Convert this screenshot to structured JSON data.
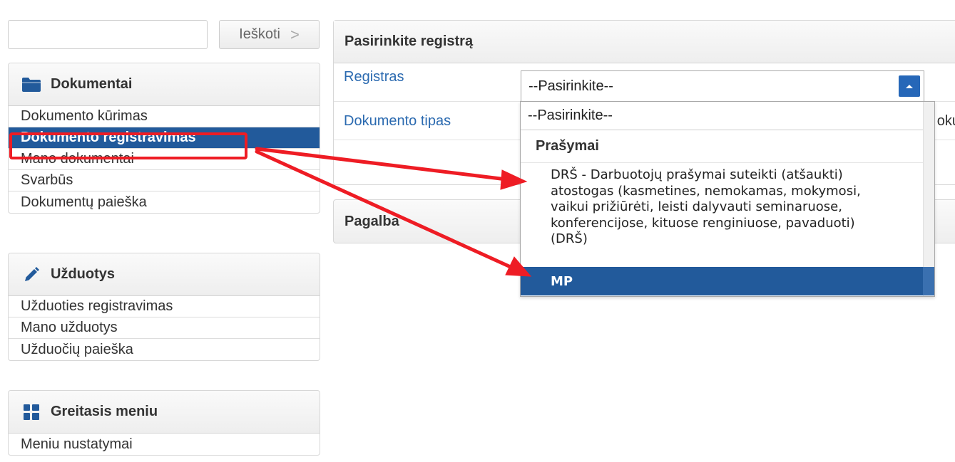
{
  "search": {
    "placeholder": "",
    "button_label": "Ieškoti",
    "button_chevron": ">"
  },
  "sidebar": {
    "documents": {
      "title": "Dokumentai",
      "icon": "folder-icon",
      "items": [
        {
          "label": "Dokumento kūrimas",
          "active": false
        },
        {
          "label": "Dokumento registravimas",
          "active": true
        },
        {
          "label": "Mano dokumentai",
          "active": false
        },
        {
          "label": "Svarbūs",
          "active": false
        },
        {
          "label": "Dokumentų paieška",
          "active": false
        }
      ]
    },
    "tasks": {
      "title": "Užduotys",
      "icon": "pencil-icon",
      "items": [
        {
          "label": "Užduoties registravimas"
        },
        {
          "label": "Mano užduotys"
        },
        {
          "label": "Užduočių paieška"
        }
      ]
    },
    "quickmenu": {
      "title": "Greitasis meniu",
      "icon": "grid-icon",
      "items": [
        {
          "label": "Meniu nustatymai"
        }
      ]
    }
  },
  "main": {
    "title": "Pasirinkite registrą",
    "fields": {
      "registry_label": "Registras",
      "registry_value": "--Pasirinkite--",
      "doctype_label": "Dokumento tipas",
      "doctype_cutoff": "oku"
    },
    "help_title": "Pagalba"
  },
  "dropdown": {
    "options": [
      "--Pasirinkite--"
    ],
    "group_label": "Prašymai",
    "group_options": [
      {
        "lines": [
          "DRŠ - Darbuotojų prašymai suteikti (atšaukti)",
          "atostogas (kasmetines, nemokamas, mokymosi,",
          "vaikui prižiūrėti, leisti dalyvauti seminaruose,",
          "konferencijose, kituose renginiuose, pavaduoti)",
          "(DRŠ)"
        ]
      },
      {
        "label": "MP",
        "selected": true
      }
    ]
  },
  "colors": {
    "active_bg": "#225a9b",
    "link_blue": "#2b6ab0",
    "annotation_red": "#ee1c24",
    "select_arrow_bg": "#2667b8"
  }
}
